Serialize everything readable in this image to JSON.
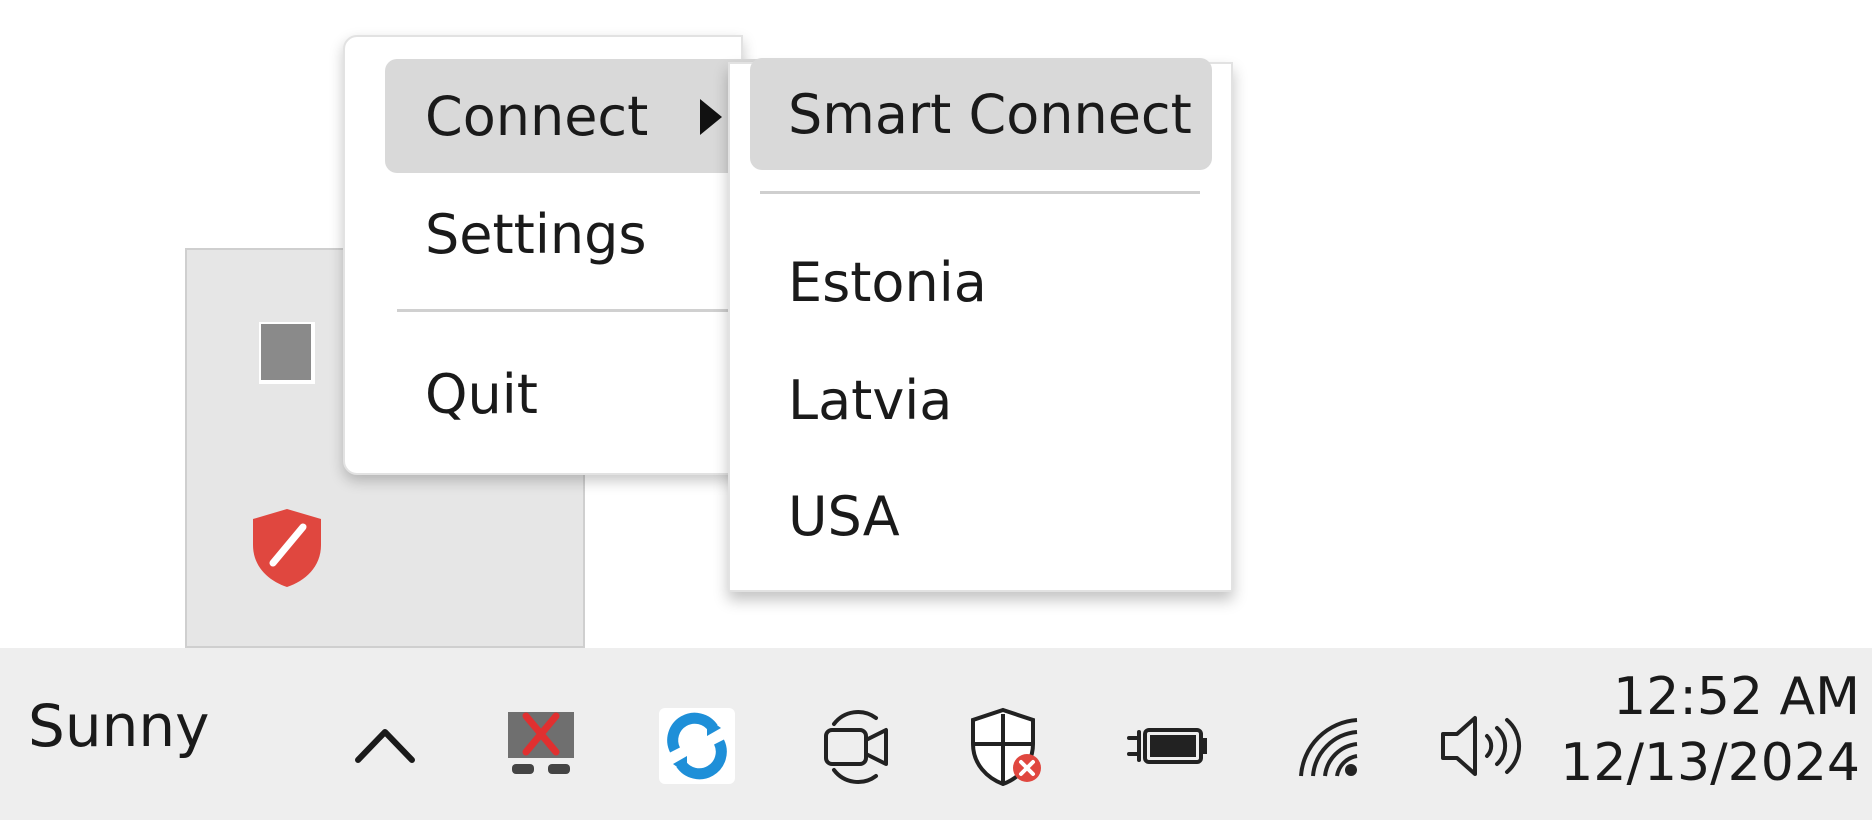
{
  "context_menu": {
    "items": [
      {
        "label": "Connect",
        "has_submenu": true,
        "highlighted": true
      },
      {
        "label": "Settings"
      },
      {
        "label": "Quit"
      }
    ]
  },
  "submenu": {
    "items": [
      {
        "label": "Smart Connect",
        "highlighted": true
      },
      {
        "label": "Estonia"
      },
      {
        "label": "Latvia"
      },
      {
        "label": "USA"
      }
    ]
  },
  "tray_overflow": {
    "icons": [
      "app-square-icon",
      "red-shield-icon"
    ]
  },
  "taskbar": {
    "weather": "Sunny",
    "tray_icons": [
      "chevron-up-icon",
      "app-error-icon",
      "sync-icon",
      "video-call-icon",
      "defender-warning-icon",
      "battery-charging-icon",
      "wifi-icon",
      "volume-icon"
    ],
    "time": "12:52 AM",
    "date": "12/13/2024"
  },
  "colors": {
    "highlight": "#d9d9d9",
    "taskbar_bg": "#eeeeee",
    "shield_red": "#e0473f",
    "sync_blue": "#1e8fd8"
  }
}
